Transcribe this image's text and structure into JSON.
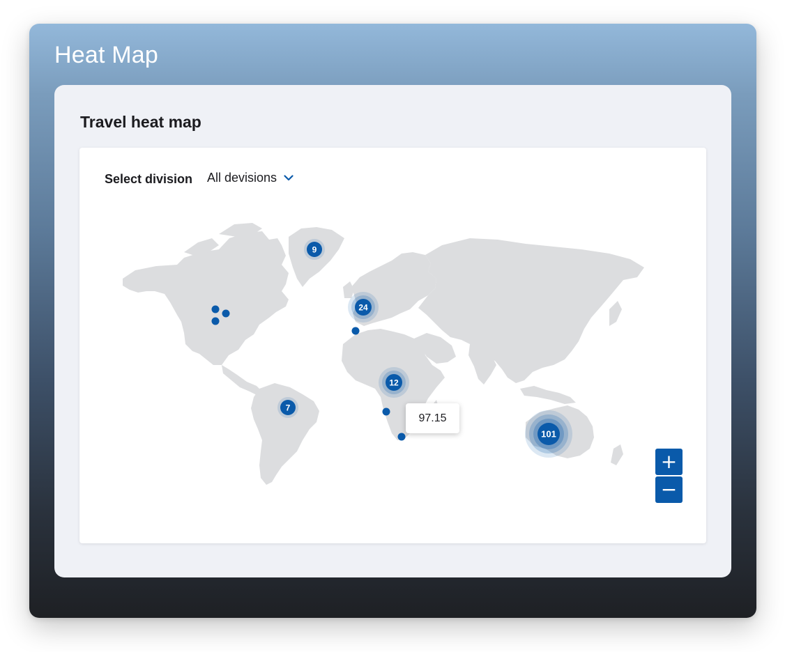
{
  "app": {
    "title": "Heat Map"
  },
  "panel": {
    "title": "Travel heat map"
  },
  "filter": {
    "label": "Select division",
    "selected": "All devisions"
  },
  "map": {
    "land_color": "#dcdddf",
    "marker_color": "#0a5aaa",
    "clusters": [
      {
        "id": "greenland",
        "count": "9",
        "size": "small"
      },
      {
        "id": "europe",
        "count": "24",
        "size": "medium"
      },
      {
        "id": "africa",
        "count": "12",
        "size": "medium"
      },
      {
        "id": "south-america",
        "count": "7",
        "size": "small"
      },
      {
        "id": "australia",
        "count": "101",
        "size": "large"
      }
    ],
    "tooltip": {
      "value": "97.15"
    }
  },
  "zoom": {
    "in_label": "+",
    "out_label": "−"
  },
  "icons": {
    "dropdown": "chevron-down-icon"
  }
}
